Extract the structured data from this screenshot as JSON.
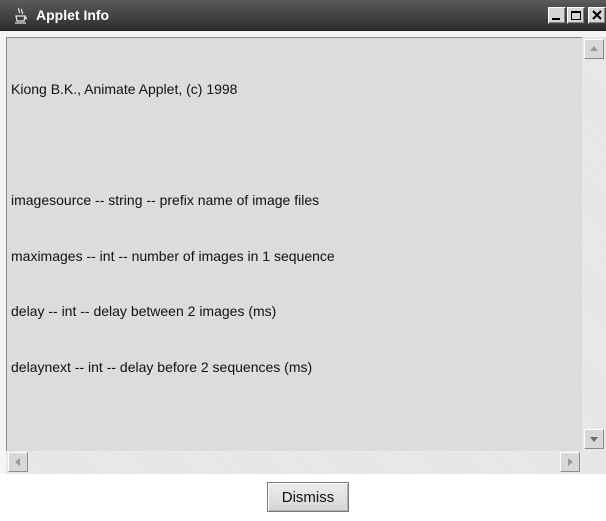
{
  "window": {
    "title": "Applet Info",
    "icon": "java-cup-icon"
  },
  "info": {
    "lines": [
      "Kiong B.K., Animate Applet, (c) 1998",
      "",
      "imagesource -- string -- prefix name of image files",
      "maximages -- int -- number of images in 1 sequence",
      "delay -- int -- delay between 2 images (ms)",
      "delaynext -- int -- delay before 2 sequences (ms)"
    ]
  },
  "footer": {
    "dismiss_label": "Dismiss"
  }
}
